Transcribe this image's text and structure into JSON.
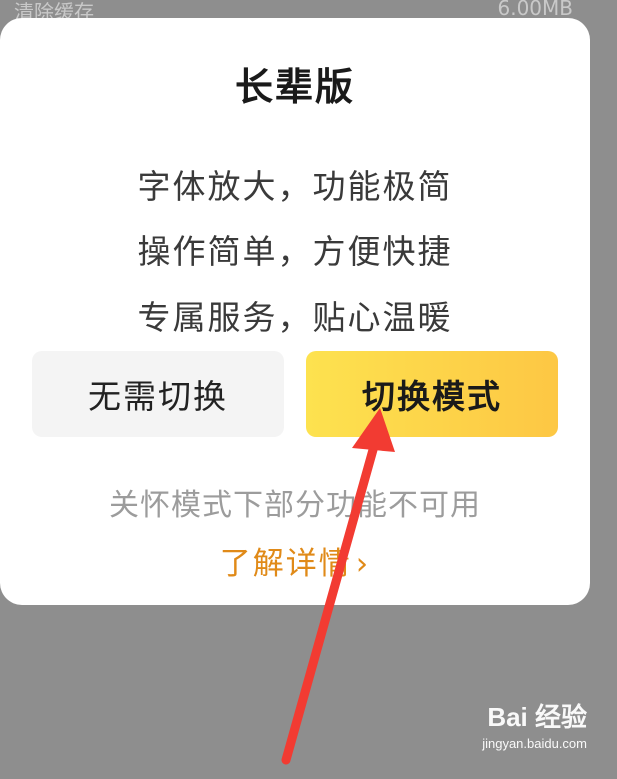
{
  "background": {
    "left_text": "清除缓存",
    "right_text": "6.00MB"
  },
  "dialog": {
    "title": "长辈版",
    "lines": [
      "字体放大，功能极简",
      "操作简单，方便快捷",
      "专属服务，贴心温暖"
    ],
    "cancel_label": "无需切换",
    "switch_label": "切换模式",
    "note": "关怀模式下部分功能不可用",
    "learn_more": "了解详情",
    "learn_more_chevron": "›"
  },
  "watermark": {
    "brand": "Bai 经验",
    "url": "jingyan.baidu.com"
  },
  "colors": {
    "overlay": "#8e8e8e",
    "accent_orange": "#e08a18",
    "button_yellow": "#fdd84a",
    "arrow_red": "#f23b32"
  }
}
